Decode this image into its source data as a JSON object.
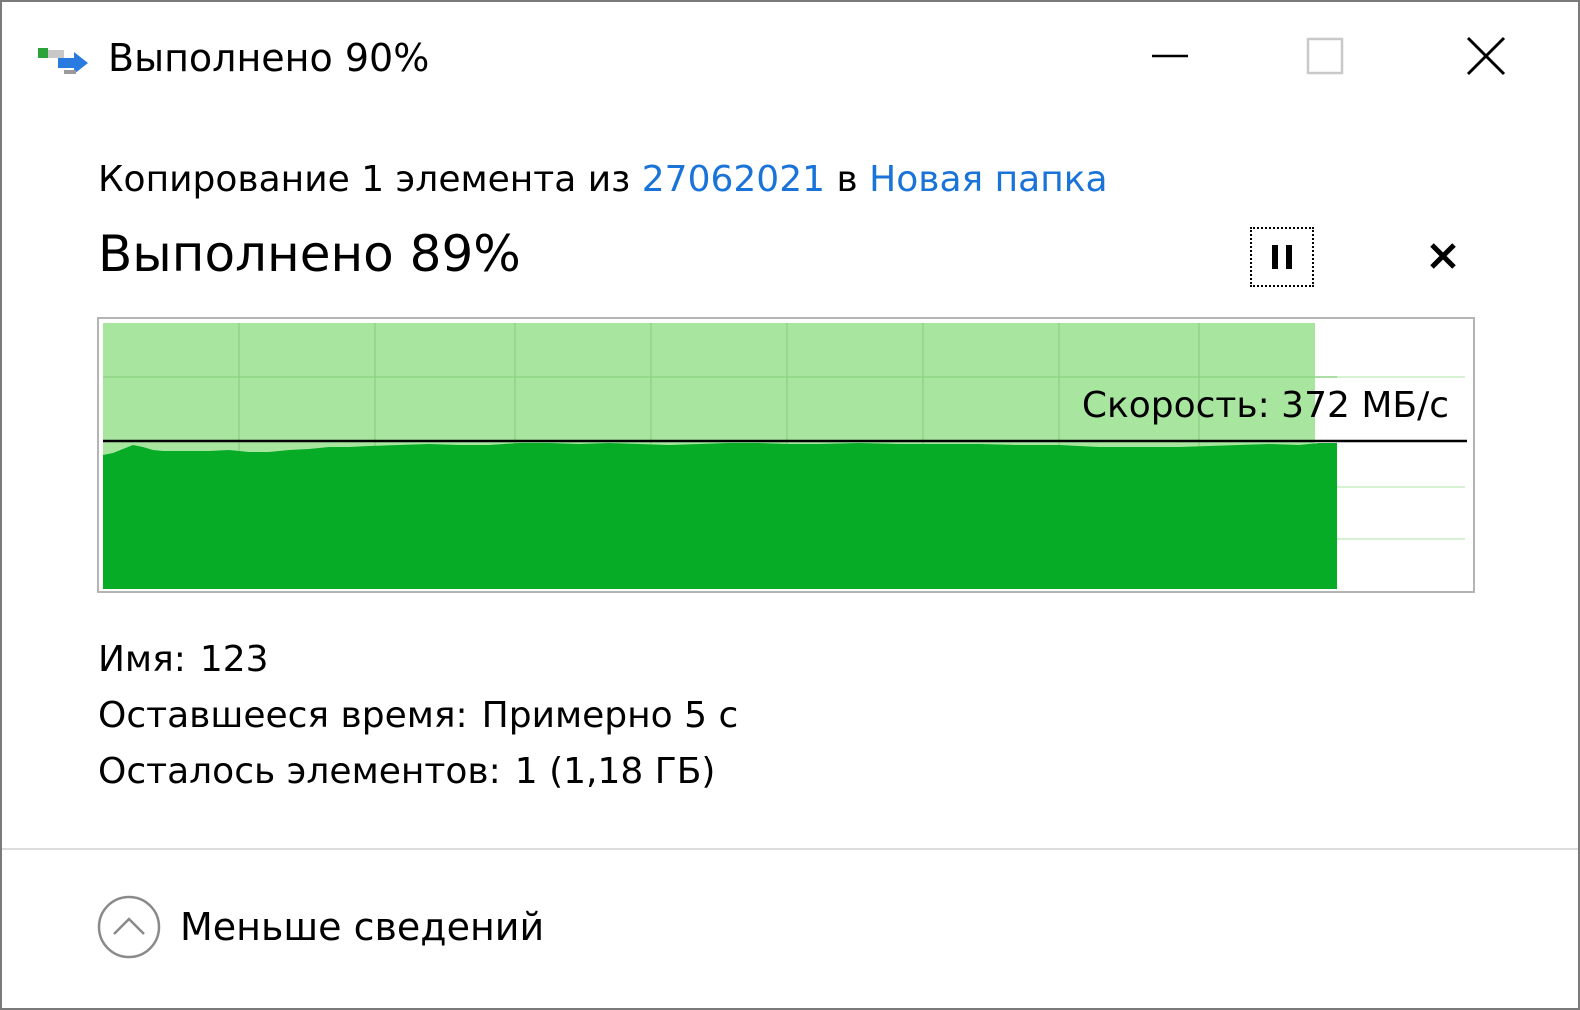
{
  "window": {
    "title": "Выполнено 90%"
  },
  "operation": {
    "prefix": "Копирование 1 элемента из",
    "source": "27062021",
    "connector": "в",
    "destination": "Новая папка"
  },
  "progress": {
    "heading": "Выполнено 89%",
    "percent": 89
  },
  "graph": {
    "speed_label": "Скорость: 372 МБ/с"
  },
  "details": {
    "name_label": "Имя:",
    "name_value": "123",
    "time_label": "Оставшееся время:",
    "time_value": "Примерно 5 с",
    "items_label": "Осталось элементов:",
    "items_value": "1 (1,18 ГБ)"
  },
  "footer": {
    "less_details": "Меньше сведений"
  },
  "colors": {
    "accent_link": "#1a73d9",
    "fill_light": "#a8e6a0",
    "fill_dark": "#06ab26"
  }
}
